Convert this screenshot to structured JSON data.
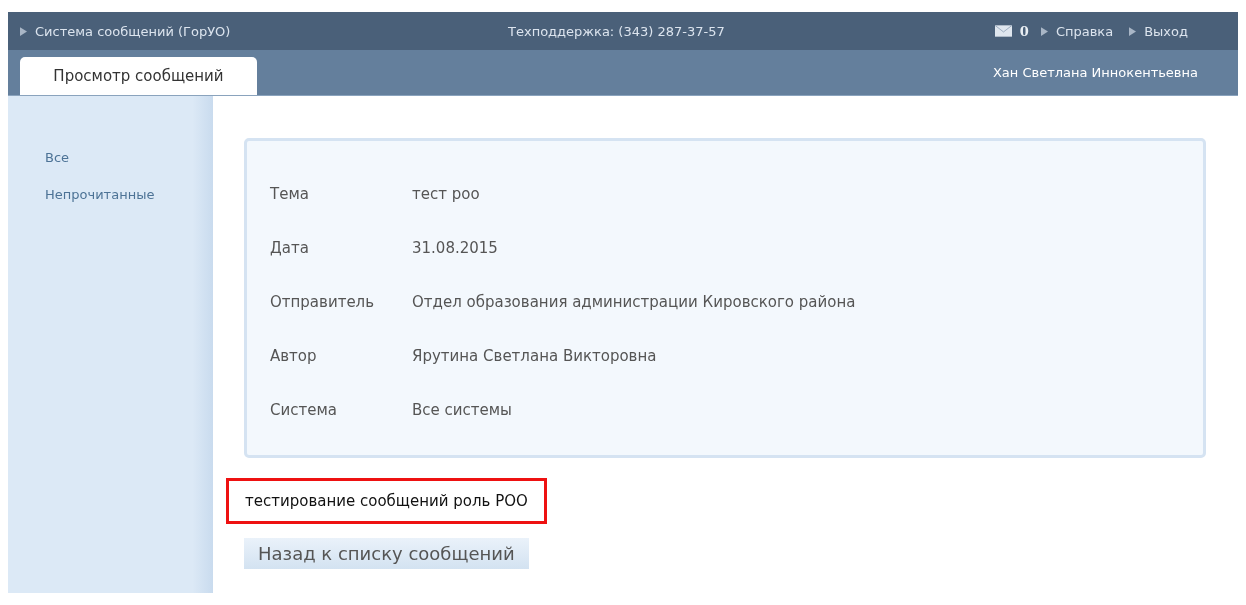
{
  "top_bar": {
    "app_title": "Система сообщений (ГорУО)",
    "support": "Техподдержка: (343) 287-37-57",
    "mail_count": "0",
    "links": [
      "Справка",
      "Выход"
    ]
  },
  "tabs": [
    {
      "label": "Просмотр сообщений",
      "selected": true
    }
  ],
  "user_name": "Хан Светлана Иннокентьевна",
  "sidebar": {
    "items": [
      "Все",
      "Непрочитанные"
    ]
  },
  "message_fields": [
    {
      "label": "Тема",
      "value": "тест роо"
    },
    {
      "label": "Дата",
      "value": "31.08.2015"
    },
    {
      "label": "Отправитель",
      "value": "Отдел образования администрации Кировского района"
    },
    {
      "label": "Автор",
      "value": "Ярутина Светлана Викторовна"
    },
    {
      "label": "Система",
      "value": "Все системы"
    }
  ],
  "message_body": {
    "text": "тестирование сообщений роль РОО",
    "highlighted": true
  },
  "back_button": "Назад к списку сообщений"
}
